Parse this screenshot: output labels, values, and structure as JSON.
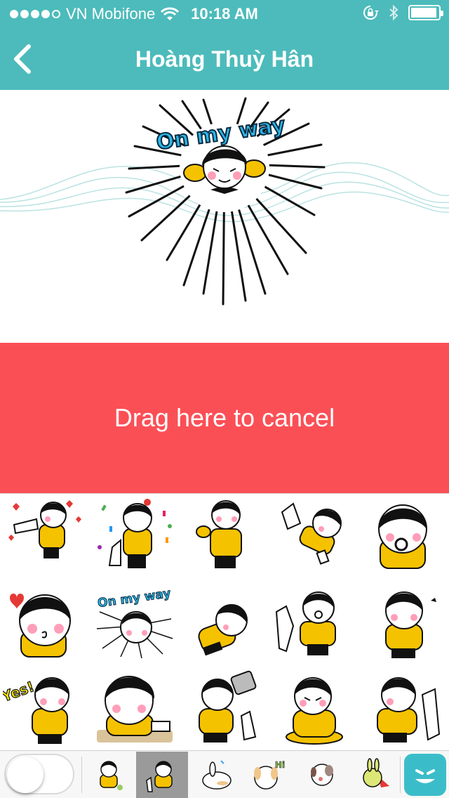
{
  "status_bar": {
    "carrier": "VN Mobifone",
    "time": "10:18 AM",
    "signal_dots_on": 4,
    "signal_dots_total": 5,
    "icons": [
      "wifi-icon",
      "rotation-lock-icon",
      "bluetooth-icon",
      "battery-icon"
    ]
  },
  "header": {
    "title": "Hoàng Thuỳ Hân",
    "back_icon": "chevron-left-icon"
  },
  "preview": {
    "sticker_caption": "On my way"
  },
  "cancel_zone": {
    "label": "Drag here to cancel"
  },
  "sticker_grid": {
    "captions": [
      "On my way",
      "Yes!"
    ]
  },
  "tab_bar": {
    "pack_captions": [
      "Hi"
    ],
    "selected_pack_index": 1
  },
  "colors": {
    "header": "#4dbbbb",
    "cancel": "#fb4f56",
    "emoji_button": "#3bbdc9",
    "sticker_yellow": "#f5c200",
    "sticker_black": "#111111"
  }
}
